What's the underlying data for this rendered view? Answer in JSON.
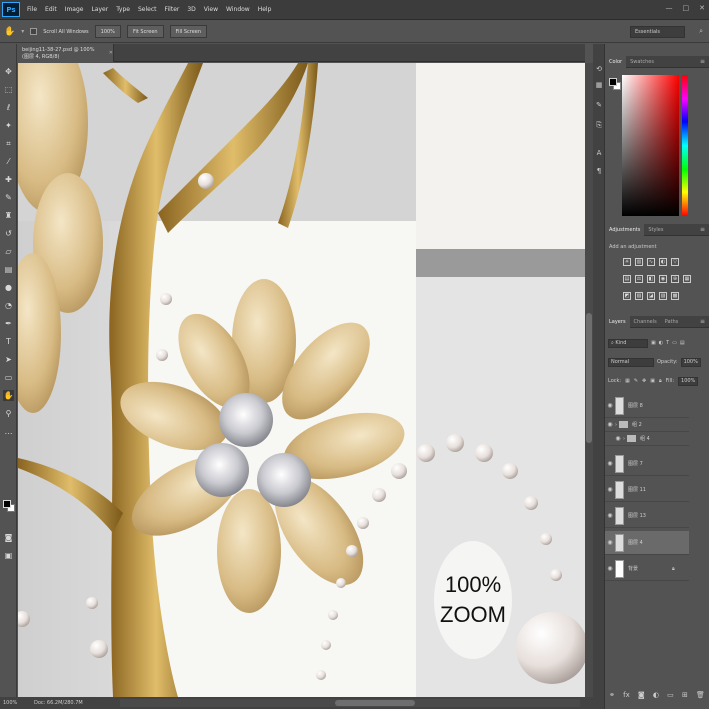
{
  "app": {
    "logo": "Ps",
    "menus": [
      "File",
      "Edit",
      "Image",
      "Layer",
      "Type",
      "Select",
      "Filter",
      "3D",
      "View",
      "Window",
      "Help"
    ],
    "window_controls": [
      "—",
      "□",
      "✕"
    ]
  },
  "options_bar": {
    "scroll_all_windows": "Scroll All Windows",
    "zoom_100": "100%",
    "fit_screen": "Fit Screen",
    "fill_screen": "Fill Screen",
    "workspace": "Essentials"
  },
  "document": {
    "tab_title": "beijing11-38-27.psd @ 100% (图层 4, RGB/8)",
    "zoom_overlay_line1": "100%",
    "zoom_overlay_line2": "ZOOM"
  },
  "status_bar": {
    "zoom": "100%",
    "doc_size": "Doc: 66.2M/280.7M"
  },
  "panels": {
    "color_tabs": [
      "Color",
      "Swatches"
    ],
    "adjust_tabs": [
      "Adjustments",
      "Styles"
    ],
    "adjust_title": "Add an adjustment",
    "layer_tabs": [
      "Layers",
      "Channels",
      "Paths"
    ],
    "kind": "Kind",
    "blend_mode": "Normal",
    "opacity_label": "Opacity:",
    "opacity": "100%",
    "lock_label": "Lock:",
    "fill_label": "Fill:",
    "fill": "100%",
    "layers": [
      {
        "name": "图层 8",
        "type": "layer",
        "selected": false
      },
      {
        "name": "组 2",
        "type": "group",
        "selected": false
      },
      {
        "name": "组 4",
        "type": "group",
        "selected": false
      },
      {
        "name": "图层 7",
        "type": "layer",
        "selected": false
      },
      {
        "name": "图层 11",
        "type": "layer",
        "selected": false
      },
      {
        "name": "图层 13",
        "type": "layer",
        "selected": false
      },
      {
        "name": "图层 4",
        "type": "layer",
        "selected": true
      },
      {
        "name": "背景",
        "type": "layer",
        "selected": false
      }
    ]
  },
  "colors": {
    "ui_dark": "#424242",
    "ui_mid": "#535353",
    "gold": "#c9a256",
    "pearl": "#f1ece8"
  }
}
